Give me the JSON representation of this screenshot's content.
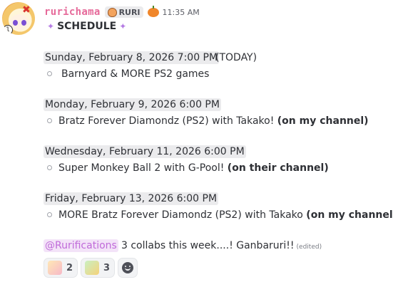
{
  "message": {
    "author": "rurichama",
    "clan_tag": "RURI",
    "timestamp": "11:35 AM",
    "title": "SCHEDULE",
    "events": [
      {
        "date": "Sunday, February 8, 2026 7:00 PM",
        "note": "(TODAY)",
        "item": "Barnyard & MORE PS2 games",
        "bold": ""
      },
      {
        "date": "Monday, February 9, 2026 6:00 PM",
        "note": "",
        "item": "Bratz Forever Diamondz (PS2) with Takako!",
        "bold": "(on my channel)"
      },
      {
        "date": "Wednesday, February 11, 2026 6:00 PM",
        "note": "",
        "item": "Super Monkey Ball 2 with G-Pool!",
        "bold": "(on their channel)"
      },
      {
        "date": "Friday, February 13, 2026 6:00 PM",
        "note": "",
        "item": "MORE Bratz Forever Diamondz (PS2) with Takako",
        "bold": "(on my channel)"
      }
    ],
    "mention": "@Rurifications",
    "text": "3 collabs this week....! Ganbaruri!!",
    "edited": "(edited)",
    "reactions": [
      {
        "emoji": "rurichama-emote",
        "count": "2"
      },
      {
        "emoji": "ruri-emote-2",
        "count": "3"
      }
    ],
    "add_reaction_icon": "smile-add-reaction-icon",
    "colors": {
      "username": "#e66a9a",
      "mention_text": "#c06ad9",
      "mention_bg": "#f3e3f8"
    }
  }
}
